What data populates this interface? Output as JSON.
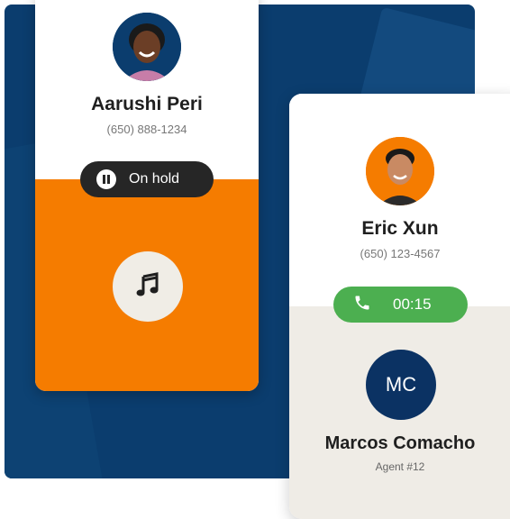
{
  "colors": {
    "background_navy": "#0b3d6e",
    "accent_orange": "#f57c00",
    "hold_pill": "#262626",
    "call_green": "#4caf50",
    "agent_circle": "#0b3263",
    "light_panel": "#efece6"
  },
  "caller_on_hold": {
    "name": "Aarushi Peri",
    "phone": "(650) 888-1234",
    "status_label": "On hold",
    "status_icon": "pause-icon",
    "music_icon": "music-note-icon"
  },
  "active_call": {
    "name": "Eric Xun",
    "phone": "(650) 123-4567",
    "call_icon": "phone-icon",
    "timer": "00:15"
  },
  "agent": {
    "initials": "MC",
    "name": "Marcos Comacho",
    "role": "Agent #12"
  }
}
